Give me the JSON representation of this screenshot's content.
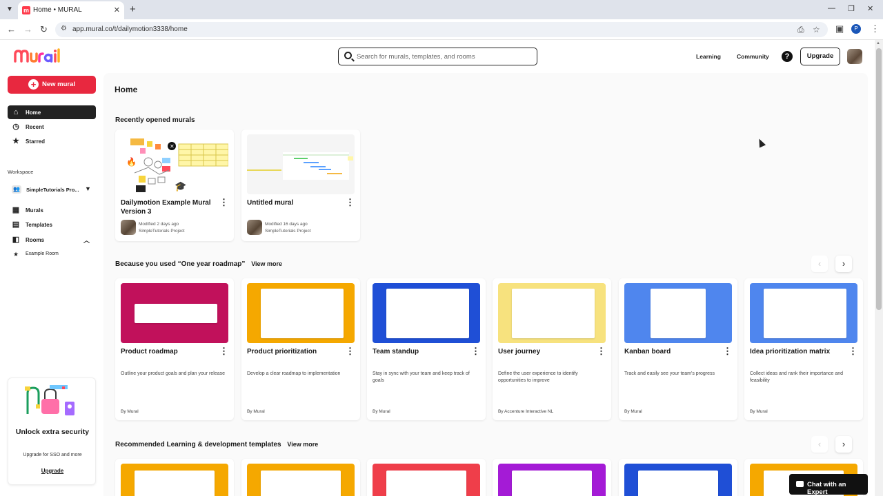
{
  "browser": {
    "tab_title": "Home • MURAL",
    "url": "app.mural.co/t/dailymotion3338/home",
    "profile_initial": "P"
  },
  "header": {
    "logo": "mural",
    "search_placeholder": "Search for murals, templates, and rooms",
    "learning": "Learning",
    "community": "Community",
    "help": "?",
    "upgrade": "Upgrade"
  },
  "sidebar": {
    "new_mural": "New mural",
    "nav": [
      {
        "label": "Home",
        "icon": "home-icon"
      },
      {
        "label": "Recent",
        "icon": "clock-icon"
      },
      {
        "label": "Starred",
        "icon": "star-icon"
      }
    ],
    "workspace_label": "Workspace",
    "workspace_name": "SimpleTutorials Pro...",
    "workspace_items": [
      {
        "label": "Murals",
        "icon": "murals-icon"
      },
      {
        "label": "Templates",
        "icon": "templates-icon"
      },
      {
        "label": "Rooms",
        "icon": "rooms-icon"
      },
      {
        "label": "Example Room",
        "icon": "star-icon"
      }
    ],
    "upsell": {
      "title": "Unlock extra security",
      "subtitle": "Upgrade for SSO and more",
      "link": "Upgrade"
    }
  },
  "main": {
    "title": "Home",
    "recent": {
      "heading": "Recently opened murals",
      "cards": [
        {
          "title": "Dailymotion Example Mural Version 3",
          "modified": "Modified 2 days ago",
          "workspace": "SimpleTutorials Project"
        },
        {
          "title": "Untitled mural",
          "modified": "Modified 16 days ago",
          "workspace": "SimpleTutorials Project"
        }
      ]
    },
    "because": {
      "heading": "Because you used  “One year roadmap”",
      "view_more": "View more",
      "cards": [
        {
          "title": "Product roadmap",
          "desc": "Outline your product goals and plan your release",
          "by": "By Mural",
          "bg": "#c1115b"
        },
        {
          "title": "Product prioritization",
          "desc": "Develop a clear roadmap to implementation",
          "by": "By Mural",
          "bg": "#f5a800"
        },
        {
          "title": "Team standup",
          "desc": "Stay in sync with your team and keep track of goals",
          "by": "By Mural",
          "bg": "#1f4fd6"
        },
        {
          "title": "User journey",
          "desc": "Define the user experience to identify opportunities to improve",
          "by": "By Accenture Interactive NL",
          "bg": "#f7e27e"
        },
        {
          "title": "Kanban board",
          "desc": "Track and easily see your team's progress",
          "by": "By Mural",
          "bg": "#4f86ee"
        },
        {
          "title": "Idea prioritization matrix",
          "desc": "Collect ideas and rank their importance and feasibility",
          "by": "By Mural",
          "bg": "#4f86ee"
        }
      ]
    },
    "recommended": {
      "heading": "Recommended Learning & development templates",
      "view_more": "View more",
      "thumb_colors": [
        "#f5a800",
        "#f5a800",
        "#ef3e4a",
        "#a41bd6",
        "#1f4fd6",
        "#f5a800"
      ]
    },
    "chat": "Chat with an Expert"
  }
}
